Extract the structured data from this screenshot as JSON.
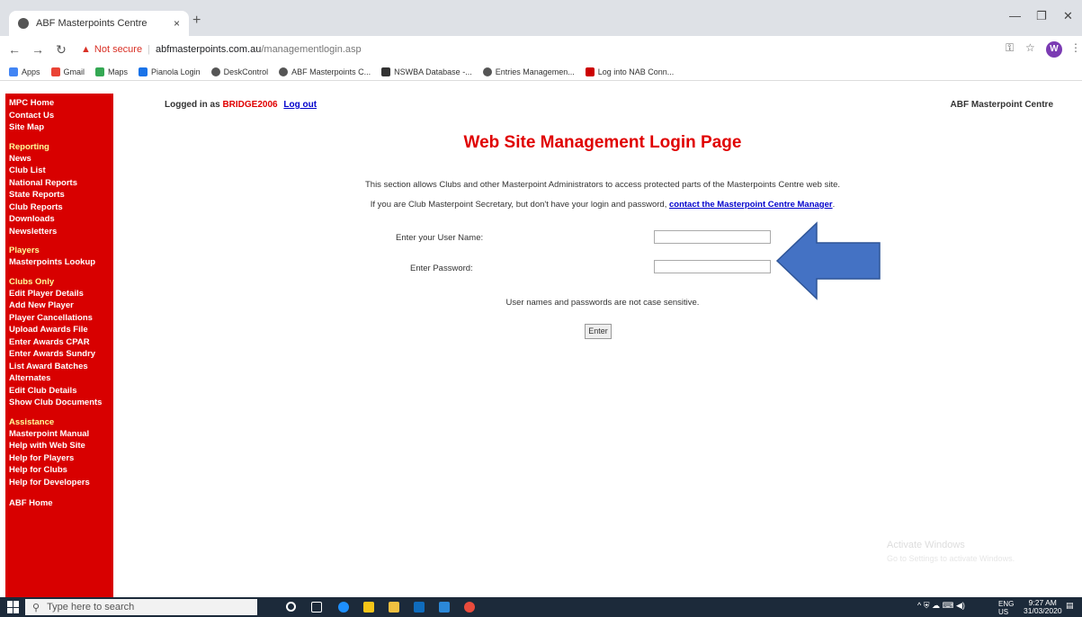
{
  "browser": {
    "tab_title": "ABF Masterpoints Centre",
    "tab_close": "×",
    "new_tab": "+",
    "not_secure": "Not secure",
    "url_host": "abfmasterpoints.com.au",
    "url_path": "/managementlogin.asp",
    "profile_initial": "W",
    "bookmarks": [
      "Apps",
      "Gmail",
      "Maps",
      "Pianola Login",
      "DeskControl",
      "ABF Masterpoints C...",
      "NSWBA Database -...",
      "Entries Managemen...",
      "Log into NAB Conn..."
    ]
  },
  "sidebar": {
    "groups": [
      {
        "section": "",
        "items": [
          "MPC Home",
          "Contact Us",
          "Site Map"
        ]
      },
      {
        "section": "Reporting",
        "items": [
          "News",
          "Club List",
          "National Reports",
          "State Reports",
          "Club Reports",
          "Downloads",
          "Newsletters"
        ]
      },
      {
        "section": "Players",
        "items": [
          "Masterpoints Lookup"
        ]
      },
      {
        "section": "Clubs Only",
        "items": [
          "Edit Player Details",
          "Add New Player",
          "Player Cancellations",
          "Upload Awards File",
          "Enter Awards CPAR",
          "Enter Awards Sundry",
          "List Award Batches",
          "Alternates",
          "Edit Club Details",
          "Show Club Documents"
        ]
      },
      {
        "section": "Assistance",
        "items": [
          "Masterpoint Manual",
          "Help with Web Site",
          "Help for Players",
          "Help for Clubs",
          "Help for Developers"
        ]
      },
      {
        "section": "",
        "items": [
          "ABF Home"
        ]
      }
    ]
  },
  "header": {
    "logged_in_prefix": "Logged in as",
    "username": "BRIDGE2006",
    "logout": "Log out",
    "site_name": "ABF Masterpoint Centre"
  },
  "main": {
    "title": "Web Site Management Login Page",
    "intro": "This section allows Clubs and other Masterpoint Administrators to access protected parts of the Masterpoints Centre web site.",
    "intro2_prefix": "If you are Club Masterpoint Secretary, but don't have your login and password,",
    "intro2_link": "contact the Masterpoint Centre Manager",
    "intro2_suffix": ".",
    "username_label": "Enter your User Name:",
    "password_label": "Enter Password:",
    "username_value": "",
    "password_value": "",
    "note": "User names and passwords are not case sensitive.",
    "enter_button": "Enter"
  },
  "windows": {
    "watermark": "Activate Windows",
    "watermark_sub": "Go to Settings to activate Windows.",
    "search_placeholder": "Type here to search",
    "lang": "ENG",
    "lang_sub": "US",
    "time": "9:27 AM",
    "date": "31/03/2020"
  },
  "colors": {
    "sidebar": "#d80000",
    "title": "#e00000",
    "link": "#0000cc",
    "arrow": "#4472c4"
  }
}
